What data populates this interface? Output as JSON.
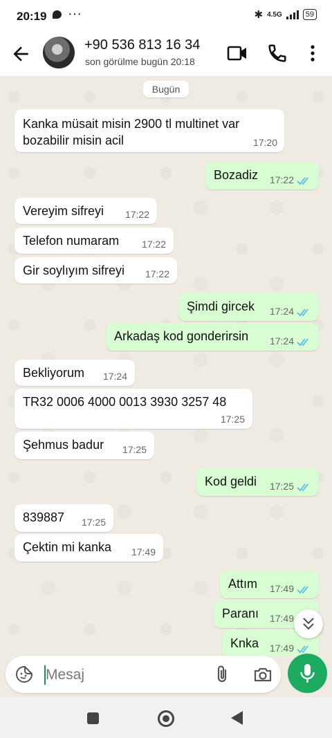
{
  "status_bar": {
    "time": "20:19",
    "network": "4.5G",
    "battery": "59"
  },
  "header": {
    "contact_name": "+90 536 813 16 34",
    "last_seen": "son görülme bugün 20:18"
  },
  "day_label": "Bugün",
  "messages": [
    {
      "dir": "in",
      "text": "Kanka müsait misin 2900 tl multinet var bozabilir misin acil",
      "time": "17:20"
    },
    {
      "dir": "out",
      "text": "Bozadiz",
      "time": "17:22",
      "read": true
    },
    {
      "dir": "in",
      "text": "Vereyim sifreyi",
      "time": "17:22"
    },
    {
      "dir": "in",
      "text": "Telefon numaram",
      "time": "17:22"
    },
    {
      "dir": "in",
      "text": "Gir soylıyım sifreyi",
      "time": "17:22"
    },
    {
      "dir": "out",
      "text": "Şimdi gircek",
      "time": "17:24",
      "read": true
    },
    {
      "dir": "out",
      "text": "Arkadaş kod gonderirsin",
      "time": "17:24",
      "read": true
    },
    {
      "dir": "in",
      "text": "Bekliyorum",
      "time": "17:24"
    },
    {
      "dir": "in",
      "text": "TR32 0006 4000 0013 3930 3257 48",
      "time": "17:25"
    },
    {
      "dir": "in",
      "text": "Şehmus badur",
      "time": "17:25"
    },
    {
      "dir": "out",
      "text": "Kod geldi",
      "time": "17:25",
      "read": true
    },
    {
      "dir": "in",
      "text": "839887",
      "time": "17:25"
    },
    {
      "dir": "in",
      "text": "Çektin mi kanka",
      "time": "17:49"
    },
    {
      "dir": "out",
      "text": "Attım",
      "time": "17:49",
      "read": true
    },
    {
      "dir": "out",
      "text": "Paranı",
      "time": "17:49",
      "read": true
    },
    {
      "dir": "out",
      "text": "Knka",
      "time": "17:49",
      "read": true
    }
  ],
  "composer": {
    "placeholder": "Mesaj",
    "value": ""
  },
  "colors": {
    "accent": "#1daa61",
    "outgoing_bubble": "#d9fdd3",
    "incoming_bubble": "#ffffff",
    "read_tick": "#53bdeb",
    "chat_bg": "#efeae2"
  }
}
